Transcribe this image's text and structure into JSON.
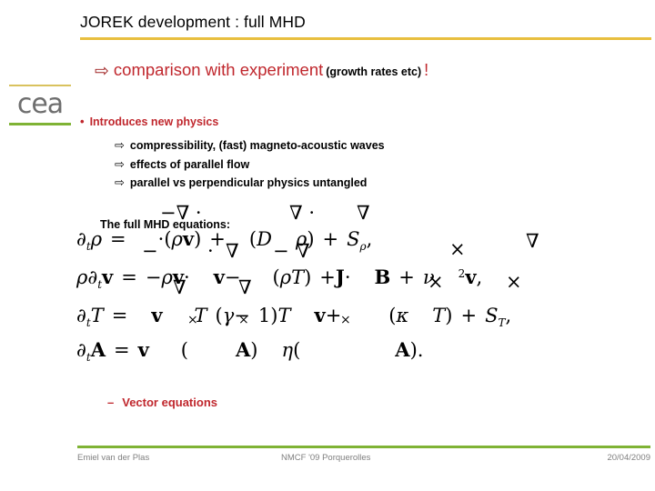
{
  "slide": {
    "title": "JOREK development : full MHD",
    "accent_gold": "#e8bf3f",
    "accent_green": "#7fb335",
    "accent_red": "#c0272d"
  },
  "logo": {
    "word": "cea",
    "rule_top_color": "#d9c25e",
    "rule_bottom_color": "#7fb335"
  },
  "subtitle": {
    "arrow": "⇨",
    "main": "comparison with experiment",
    "paren": "(growth rates etc)",
    "bang": "!"
  },
  "bullets": {
    "level1": {
      "marker": "•",
      "text": "Introduces new physics"
    },
    "level2_marker": "⇨",
    "level2": [
      "compressibility, (fast) magneto-acoustic waves",
      "effects of parallel flow",
      "parallel vs perpendicular physics untangled"
    ]
  },
  "equations": {
    "caption": "The full MHD equations:",
    "lines": [
      {
        "id": "continuity",
        "text": "∂tρ = −∇·(ρv) + ∇·(D∇ρ) + Sρ,"
      },
      {
        "id": "momentum",
        "text": "ρ∂tv = −ρv·∇v − ∇(ρT) + J×B + ν∇²v,"
      },
      {
        "id": "temperature",
        "text": "∂tT = −v·∇T − (γ − 1)T∇·v + ∇·(κ∇T) + ST,"
      },
      {
        "id": "induction",
        "text": "∂tA = v×(∇×A) − η(∇×∇×A)."
      }
    ],
    "stray_glyphs": [
      "−∇ ·",
      "∇ ·",
      "∇",
      "∇",
      "−",
      "·",
      "∇",
      "−",
      "∇",
      "×",
      "∇",
      "∇",
      "×",
      "×",
      "×",
      "×",
      "×"
    ]
  },
  "dash_item": {
    "dash": "–",
    "text": "Vector equations"
  },
  "footer": {
    "author": "Emiel van der Plas",
    "event": "NMCF '09 Porquerolles",
    "date": "20/04/2009"
  }
}
